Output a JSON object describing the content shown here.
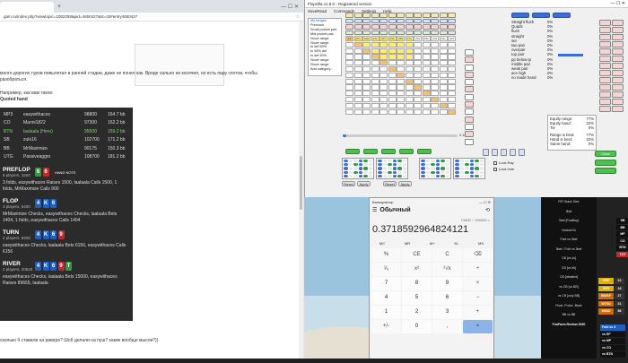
{
  "browser": {
    "tab_label": "",
    "address": "gam.ru/index.php?viewtopic=1062258&pid=4650427&st=40#entry4650427",
    "forum_text1": "много дорогих туров повылетал в ранней стадии, даже не понял как. Вроде сильно не косячил, но есть пару спотов, чтобы",
    "forum_text2": "разобраться.",
    "forum_text3": "Например, как вам такое:",
    "quote_author": "Quoted hand",
    "hand": {
      "players": [
        {
          "pos": "MP3",
          "name": "easywithaces",
          "stack": "98800",
          "bb": "164.7 bb"
        },
        {
          "pos": "CO",
          "name": "Manni1822",
          "stack": "97300",
          "bb": "162.2 bb"
        },
        {
          "pos": "BTN",
          "name": "laalaala (Hero)",
          "stack": "95500",
          "bb": "159.2 bb"
        },
        {
          "pos": "SB",
          "name": "zulo16",
          "stack": "102700",
          "bb": "171.2 bb"
        },
        {
          "pos": "BB",
          "name": "MrMaximize",
          "stack": "90175",
          "bb": "150.3 bb"
        },
        {
          "pos": "UTG",
          "name": "Passiveaggro",
          "stack": "108700",
          "bb": "181.2 bb"
        }
      ],
      "preflop": {
        "title": "PREFLOP",
        "sub": "8 players, 1500",
        "cards": [
          "6",
          "6"
        ],
        "note": "HAND NOTE",
        "text": "3 folds, easywithaces Raises 1500, laalaala Calls 1500, 1 folds, MrMaximize Calls 900"
      },
      "flop": {
        "title": "FLOP",
        "sub": "3 players, 5400",
        "cards": [
          "4",
          "K",
          "6"
        ],
        "text": "MrMaximize Checks, easywithaces Checks, laalaala Bets 1404, 1 folds, easywithaces Calls 1404"
      },
      "turn": {
        "title": "TURN",
        "sub": "2 players, 8208",
        "cards": [
          "4",
          "K",
          "6",
          "9"
        ],
        "text": "easywithaces Checks, laalaala Bets 6156, easywithaces Calls 6156"
      },
      "river": {
        "title": "RIVER",
        "sub": "2 players, 20520",
        "cards": [
          "4",
          "K",
          "6",
          "9",
          "T"
        ],
        "text": "easywithaces Checks, laalaala Bets 15000, easywithaces Raises 89665, laalaala"
      }
    },
    "forum_text4": "сколько б ставили на ривере? Шоб делали на пуш? какие вообще мысли?))"
  },
  "flopzilla": {
    "title": "Flopzilla v1.8.0 - Registered version",
    "menu": [
      "SaveRead",
      "Commands",
      "Settings",
      "Help"
    ],
    "range_list": [
      "My ranges",
      "Premium",
      "Small pocket pair",
      "Mid pocket pair",
      "Stove range",
      "Stove range",
      "tu def 50%",
      "tu 55% def",
      "tu def 40%",
      "Stove range",
      "Stove range",
      "Add category..."
    ],
    "hands_row": [
      "AA",
      "AKs",
      "AQs",
      "AJs",
      "ATs",
      "A9s",
      "A8s",
      "A7s",
      "A6s",
      "A5s",
      "A4s",
      "A3s",
      "A2s"
    ],
    "pct_label": "2.18%",
    "stats_labels": [
      "Straight flush",
      "Quads",
      "flush",
      "straight",
      "set",
      "two pair",
      "overpair",
      "top pair",
      "pp below tp",
      "middle pair",
      "weak pair",
      "ace high",
      "no made hand"
    ],
    "stats_values": [
      "0%",
      "0%",
      "0%",
      "0%",
      "0%",
      "0%",
      "0%",
      "0%",
      "0%",
      "0%",
      "0%",
      "0%",
      "0%"
    ],
    "equity": {
      "label1": "Equity range:",
      "val1": "77%",
      "label2": "Equity hand:",
      "val2": "22%",
      "label3": "Tie",
      "val3": "0%"
    },
    "range_vs": {
      "l1": "Range is best:",
      "v1": "77%",
      "l2": "Hand is best:",
      "v2": "22%",
      "l3": "Same hand:",
      "v3": "0%"
    },
    "buttons": {
      "clear": "Clear",
      "reset": "Reset",
      "apply": "Apply",
      "lock_ray": "Lock Ray",
      "lock_hole": "Lock hole"
    },
    "ranges_header": "ranges"
  },
  "calculator": {
    "title": "Калькулятор",
    "mode": "Обычный",
    "expr": "74400 ÷ 199000 =",
    "display": "0.3718592964824121",
    "mem": [
      "MC",
      "MR",
      "M+",
      "M-",
      "MS"
    ],
    "keys": [
      [
        "%",
        "CE",
        "C",
        "⌫"
      ],
      [
        "¹⁄ₓ",
        "x²",
        "²√x",
        "÷"
      ],
      [
        "7",
        "8",
        "9",
        "×"
      ],
      [
        "4",
        "5",
        "6",
        "−"
      ],
      [
        "1",
        "2",
        "3",
        "+"
      ],
      [
        "+/-",
        "0",
        ",",
        "="
      ]
    ]
  },
  "hud": {
    "items": [
      "RFI Stack Size",
      "3bet",
      "3bet [Postflop]",
      "Nutand AI",
      "Fold vs 3bet",
      "3bet / Fold vs 3bet",
      "CB [vs ss]",
      "CB [vs bb]",
      "CB [detailed]",
      "vs CB [vs BB]",
      "vs CB [only BB]",
      "Float -Probe -Bank",
      "BB vs BB",
      "FunFarm Review 2020",
      ""
    ],
    "right_tags": [
      "SB",
      "BB",
      "MP",
      "CO",
      "BTN",
      "TOT"
    ],
    "stat_rows": [
      {
        "tag": "VPIP",
        "val": "22",
        "color": "#e0b000"
      },
      {
        "tag": "PFR",
        "val": "16",
        "color": "#e0b000"
      },
      {
        "tag": "WWSF",
        "val": "47",
        "color": "#d46a00"
      },
      {
        "tag": "WTSD",
        "val": "31",
        "color": "#d46a00"
      },
      {
        "tag": "W$SD",
        "val": "56",
        "color": "#d46a00"
      }
    ],
    "bottom_tags": [
      "Fold vs 3",
      "vs EP",
      "vs MP",
      "vs CO",
      "vs BTN",
      "vs SB"
    ]
  },
  "colors": {
    "accent": "#1f5fbf",
    "green": "#2e9c3c",
    "red": "#c8282a"
  }
}
